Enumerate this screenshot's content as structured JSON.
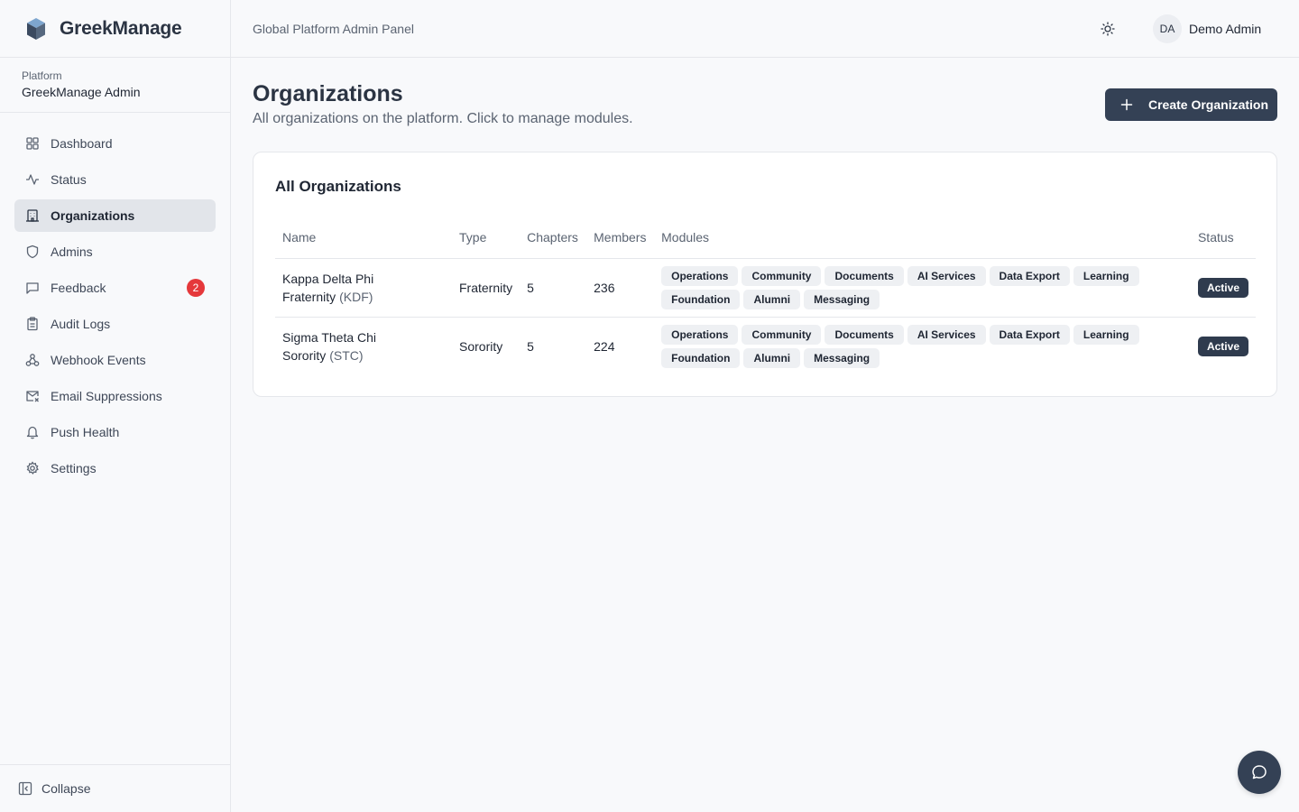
{
  "brand": {
    "name": "GreekManage"
  },
  "platform": {
    "label": "Platform",
    "name": "GreekManage Admin"
  },
  "sidebar": {
    "items": [
      {
        "label": "Dashboard",
        "icon": "dashboard-icon"
      },
      {
        "label": "Status",
        "icon": "activity-icon"
      },
      {
        "label": "Organizations",
        "icon": "building-icon",
        "active": true
      },
      {
        "label": "Admins",
        "icon": "shield-icon"
      },
      {
        "label": "Feedback",
        "icon": "message-square-icon",
        "badge": "2"
      },
      {
        "label": "Audit Logs",
        "icon": "clipboard-icon"
      },
      {
        "label": "Webhook Events",
        "icon": "webhook-icon"
      },
      {
        "label": "Email Suppressions",
        "icon": "mail-x-icon"
      },
      {
        "label": "Push Health",
        "icon": "bell-icon"
      },
      {
        "label": "Settings",
        "icon": "gear-icon"
      }
    ],
    "collapse_label": "Collapse"
  },
  "header": {
    "title": "Global Platform Admin Panel",
    "user_initials": "DA",
    "user_name": "Demo Admin"
  },
  "page": {
    "title": "Organizations",
    "subtitle": "All organizations on the platform. Click to manage modules.",
    "create_label": "Create Organization"
  },
  "card": {
    "title": "All Organizations",
    "columns": [
      "Name",
      "Type",
      "Chapters",
      "Members",
      "Modules",
      "Status"
    ],
    "rows": [
      {
        "name": "Kappa Delta Phi Fraternity",
        "abbr": "(KDF)",
        "type": "Fraternity",
        "chapters": "5",
        "members": "236",
        "modules": [
          "Operations",
          "Community",
          "Documents",
          "AI Services",
          "Data Export",
          "Learning",
          "Foundation",
          "Alumni",
          "Messaging"
        ],
        "status": "Active"
      },
      {
        "name": "Sigma Theta Chi Sorority",
        "abbr": "(STC)",
        "type": "Sorority",
        "chapters": "5",
        "members": "224",
        "modules": [
          "Operations",
          "Community",
          "Documents",
          "AI Services",
          "Data Export",
          "Learning",
          "Foundation",
          "Alumni",
          "Messaging"
        ],
        "status": "Active"
      }
    ]
  },
  "colors": {
    "accent": "#344155",
    "badge": "#e5383b",
    "active_nav_bg": "#e2e5ea",
    "tag_bg": "#eef0f3"
  }
}
